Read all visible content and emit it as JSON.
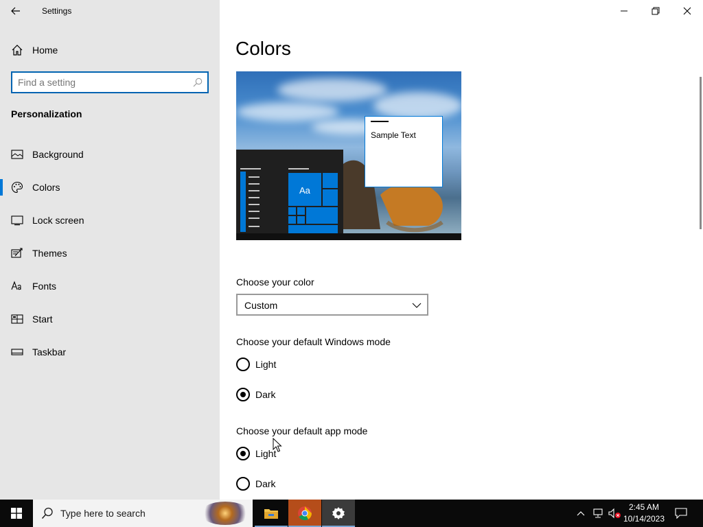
{
  "window": {
    "app_title": "Settings"
  },
  "sidebar": {
    "home_label": "Home",
    "search_placeholder": "Find a setting",
    "section_title": "Personalization",
    "items": [
      {
        "label": "Background",
        "icon": "picture-icon"
      },
      {
        "label": "Colors",
        "icon": "palette-icon",
        "active": true
      },
      {
        "label": "Lock screen",
        "icon": "lock-screen-icon"
      },
      {
        "label": "Themes",
        "icon": "themes-icon"
      },
      {
        "label": "Fonts",
        "icon": "fonts-icon"
      },
      {
        "label": "Start",
        "icon": "start-icon"
      },
      {
        "label": "Taskbar",
        "icon": "taskbar-icon"
      }
    ]
  },
  "main": {
    "title": "Colors",
    "preview": {
      "tile_label": "Aa",
      "sample_text": "Sample Text"
    },
    "choose_color": {
      "label": "Choose your color",
      "value": "Custom"
    },
    "windows_mode": {
      "label": "Choose your default Windows mode",
      "options": [
        "Light",
        "Dark"
      ],
      "selected": "Dark"
    },
    "app_mode": {
      "label": "Choose your default app mode",
      "options": [
        "Light",
        "Dark"
      ],
      "selected": "Light"
    }
  },
  "taskbar": {
    "search_text": "Type here to search",
    "time": "2:45 AM",
    "date": "10/14/2023"
  },
  "colors": {
    "accent": "#0078d7",
    "sidebar_bg": "#e6e6e6",
    "taskbar_bg": "#0a0a0a"
  }
}
